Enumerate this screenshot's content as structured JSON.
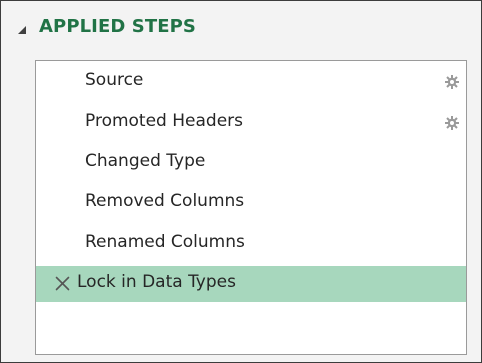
{
  "section": {
    "title": "APPLIED STEPS",
    "collapse_icon": "triangle-down-icon"
  },
  "steps": [
    {
      "label": "Source",
      "has_settings": true,
      "settings_icon": "gear-icon"
    },
    {
      "label": "Promoted Headers",
      "has_settings": true,
      "settings_icon": "gear-icon"
    },
    {
      "label": "Changed Type",
      "has_settings": false
    },
    {
      "label": "Removed Columns",
      "has_settings": false
    },
    {
      "label": "Renamed Columns",
      "has_settings": false
    },
    {
      "label": "Lock in Data Types",
      "has_settings": false,
      "selected": true,
      "delete_icon": "close-icon"
    }
  ],
  "colors": {
    "title": "#217346",
    "selected_row": "#a7d7bd",
    "panel_border": "#9a9a9a",
    "background": "#f3f3f3"
  }
}
